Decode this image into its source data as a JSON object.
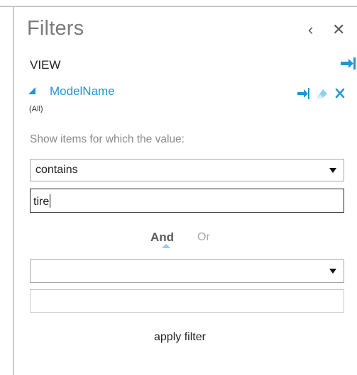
{
  "panel": {
    "title": "Filters",
    "view_label": "VIEW"
  },
  "field": {
    "name": "ModelName",
    "summary": "(All)"
  },
  "filter": {
    "prompt": "Show items for which the value:",
    "operator1": "contains",
    "value1": "tire",
    "connector_and": "And",
    "connector_or": "Or",
    "operator2": "",
    "value2": "",
    "apply_label": "apply filter"
  },
  "colors": {
    "accent": "#1e97d4",
    "text": "#222222",
    "muted": "#8a8a8a"
  },
  "icons": [
    "back-icon",
    "close-icon",
    "move-to-columns-icon",
    "collapse-triangle-icon",
    "move-icon",
    "clear-filter-icon",
    "remove-icon",
    "dropdown-caret-icon"
  ]
}
